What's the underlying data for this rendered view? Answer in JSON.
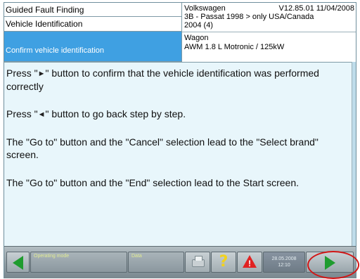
{
  "header": {
    "nav": {
      "item1": "Guided Fault Finding",
      "item2": "Vehicle Identification",
      "item3_active": "Confirm vehicle identification"
    },
    "vehicle": {
      "make": "Volkswagen",
      "version": "V12.85.01 11/04/2008",
      "model": "3B - Passat 1998 > only USA/Canada",
      "year": "2004 (4)",
      "body": "Wagon",
      "engine": "AWM 1.8 L Motronic / 125kW"
    }
  },
  "main": {
    "p1_before": "Press \"",
    "p1_glyph": "►",
    "p1_after": "\" button to confirm that the vehicle identification was performed correctly",
    "p2_before": "Press \"",
    "p2_glyph": "◄",
    "p2_after": "\" button to go back step by step.",
    "p3": "The \"Go to\" button and the \"Cancel\" selection lead to the \"Select brand\" screen.",
    "p4": "The \"Go to\" button and the \"End\" selection lead to the Start screen."
  },
  "toolbar": {
    "operating_mode_label": "Operating mode",
    "data_label": "Data",
    "date": "28.05.2008",
    "time": "12:10"
  },
  "colors": {
    "active_nav_bg": "#3fa0e2",
    "content_bg": "#e8f6fb",
    "arrow_green": "#1f9c2f",
    "highlight_ring": "#d11616"
  }
}
